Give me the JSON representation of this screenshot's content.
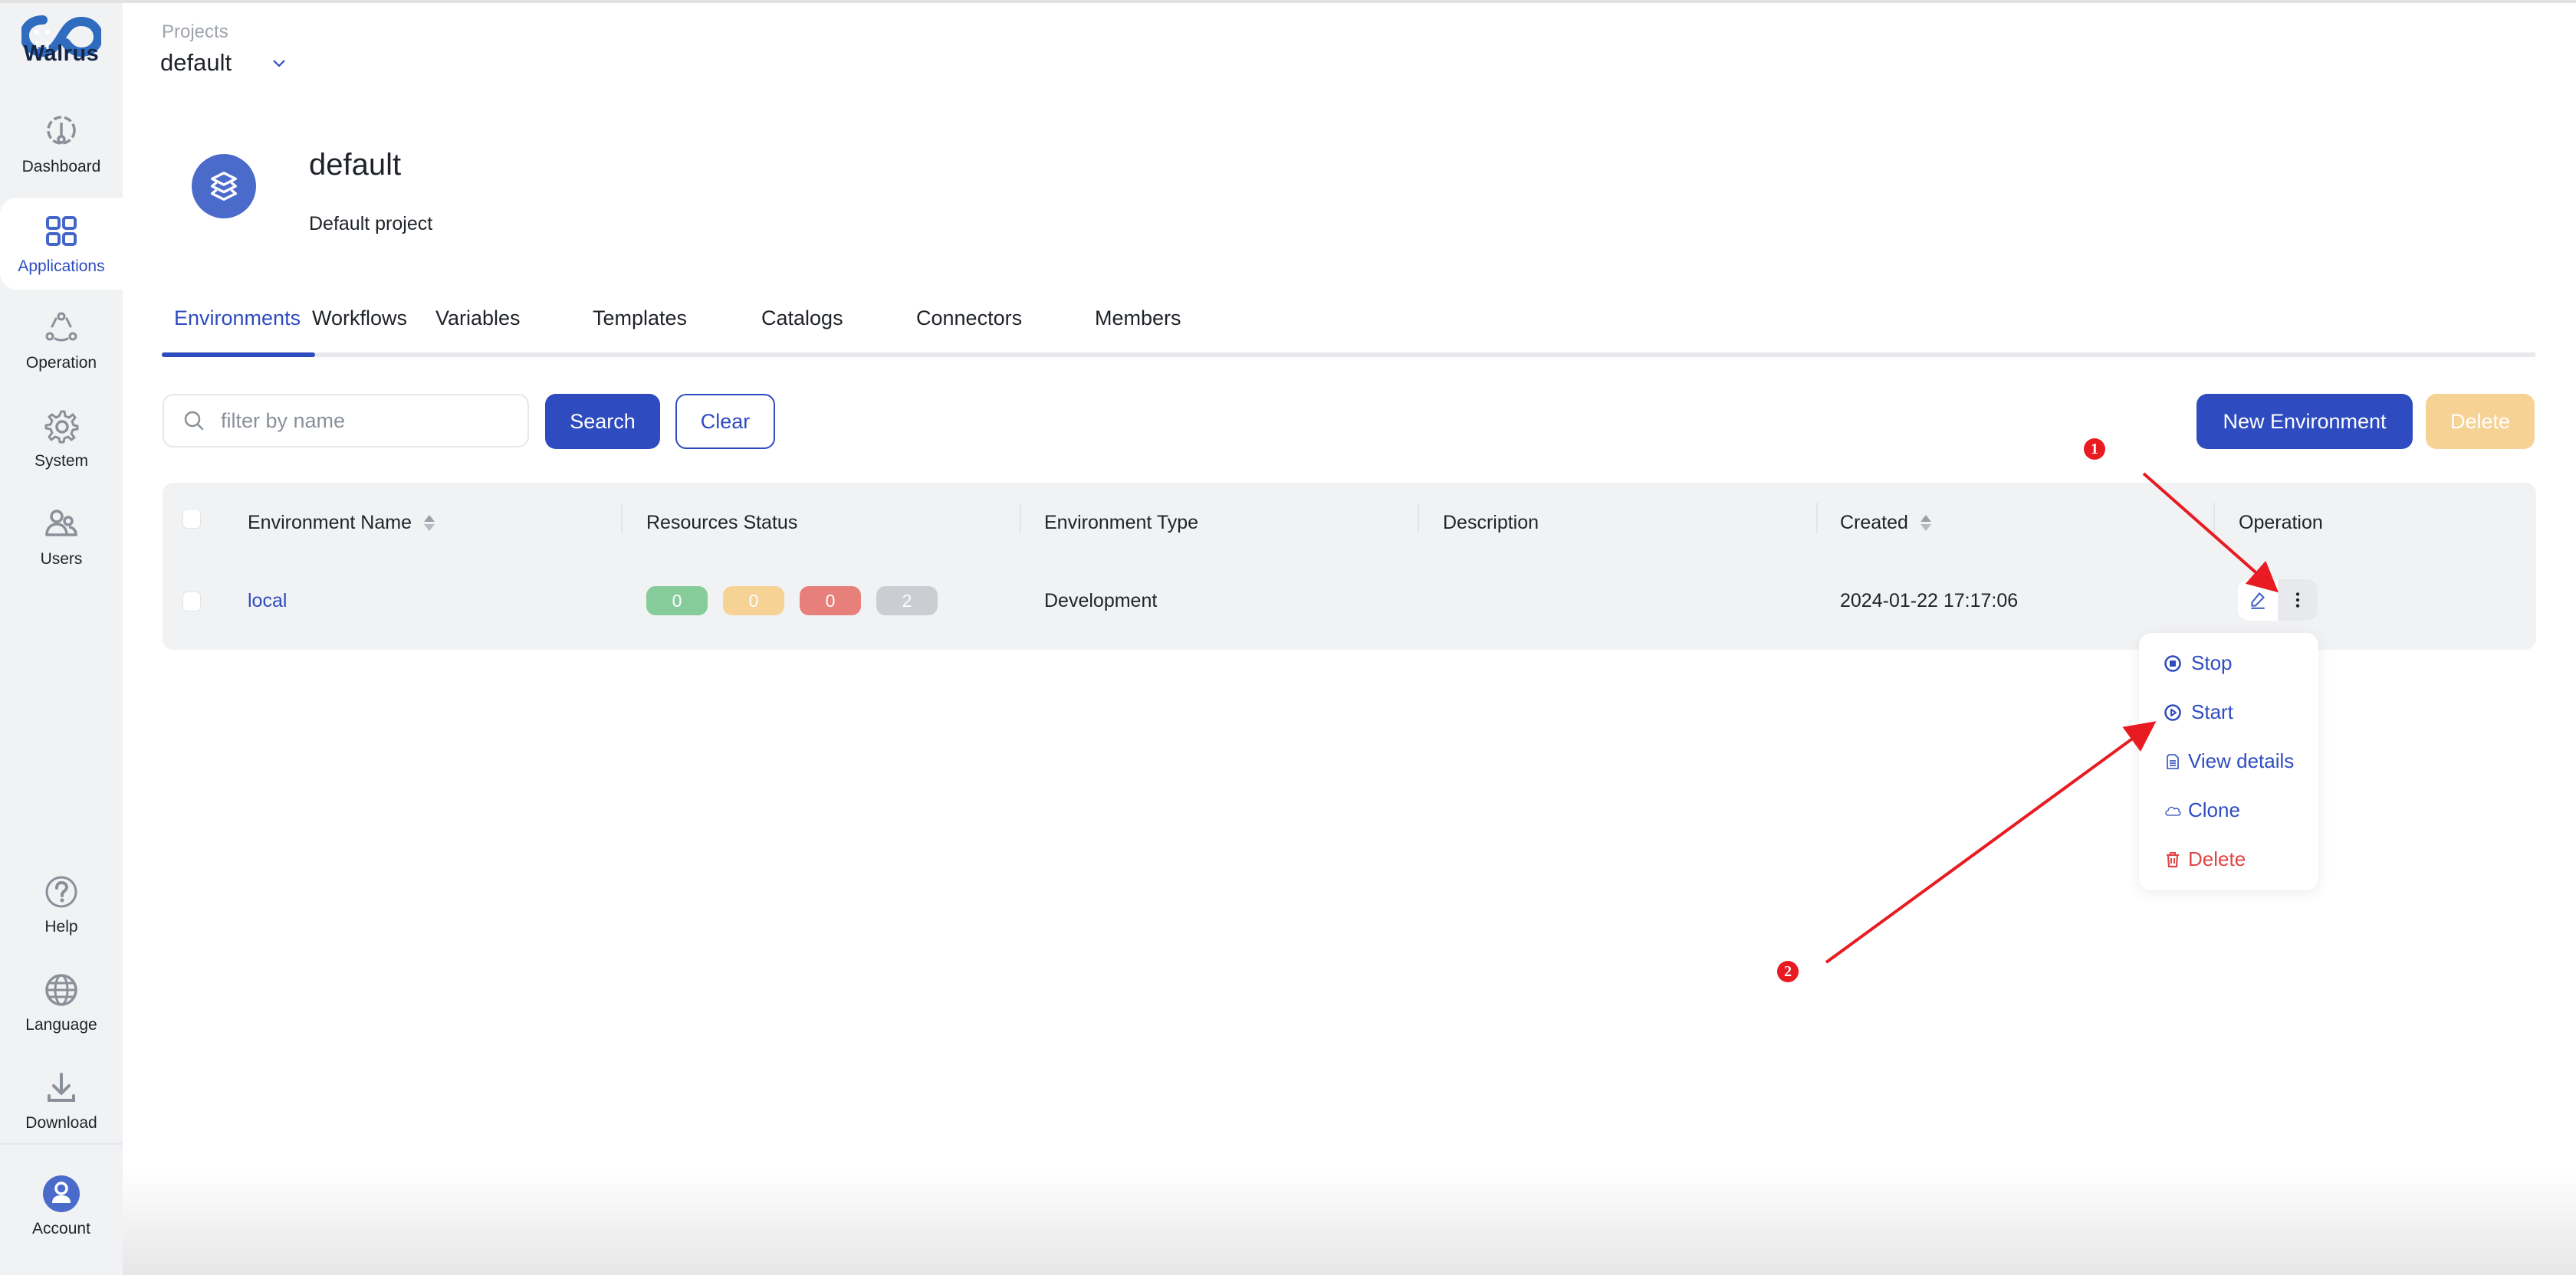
{
  "app": {
    "name": "Walrus"
  },
  "sidebar": {
    "items": [
      {
        "label": "Dashboard",
        "icon": "dashboard-icon",
        "active": false
      },
      {
        "label": "Applications",
        "icon": "applications-grid-icon",
        "active": true
      },
      {
        "label": "Operation",
        "icon": "operation-icon",
        "active": false
      },
      {
        "label": "System",
        "icon": "gear-icon",
        "active": false
      },
      {
        "label": "Users",
        "icon": "users-icon",
        "active": false
      }
    ],
    "bottom_items": [
      {
        "label": "Help",
        "icon": "help-icon"
      },
      {
        "label": "Language",
        "icon": "globe-icon"
      },
      {
        "label": "Download",
        "icon": "download-icon"
      }
    ],
    "account": {
      "label": "Account",
      "icon": "account-avatar-icon"
    }
  },
  "header": {
    "projects_label": "Projects",
    "selected_project": "default"
  },
  "project": {
    "title": "default",
    "description": "Default project",
    "icon": "layers-icon"
  },
  "tabs": [
    {
      "label": "Environments",
      "active": true
    },
    {
      "label": "Workflows",
      "active": false
    },
    {
      "label": "Variables",
      "active": false
    },
    {
      "label": "Templates",
      "active": false
    },
    {
      "label": "Catalogs",
      "active": false
    },
    {
      "label": "Connectors",
      "active": false
    },
    {
      "label": "Members",
      "active": false
    }
  ],
  "toolbar": {
    "search_placeholder": "filter by name",
    "search_value": "",
    "search_label": "Search",
    "clear_label": "Clear",
    "new_label": "New Environment",
    "delete_label": "Delete"
  },
  "table": {
    "columns": [
      {
        "label": "Environment Name",
        "sortable": true
      },
      {
        "label": "Resources Status",
        "sortable": false
      },
      {
        "label": "Environment Type",
        "sortable": false
      },
      {
        "label": "Description",
        "sortable": false
      },
      {
        "label": "Created",
        "sortable": true
      },
      {
        "label": "Operation",
        "sortable": false
      }
    ],
    "rows": [
      {
        "name": "local",
        "status_counts": [
          {
            "value": "0",
            "color": "#86cc9b",
            "kind": "ready"
          },
          {
            "value": "0",
            "color": "#f6d295",
            "kind": "transitioning"
          },
          {
            "value": "0",
            "color": "#e77f7a",
            "kind": "error"
          },
          {
            "value": "2",
            "color": "#cbcdd2",
            "kind": "inactive"
          }
        ],
        "type": "Development",
        "description": "",
        "created": "2024-01-22 17:17:06"
      }
    ]
  },
  "dropdown_menu": {
    "items": [
      {
        "label": "Stop",
        "icon": "stop-circle-icon",
        "danger": false
      },
      {
        "label": "Start",
        "icon": "play-circle-icon",
        "danger": false
      },
      {
        "label": "View details",
        "icon": "document-icon",
        "danger": false
      },
      {
        "label": "Clone",
        "icon": "cloud-icon",
        "danger": false
      },
      {
        "label": "Delete",
        "icon": "trash-icon",
        "danger": true
      }
    ]
  },
  "annotations": {
    "markers": [
      {
        "label": "1"
      },
      {
        "label": "2"
      }
    ],
    "color": "#e81b22"
  },
  "colors": {
    "primary": "#2e4cbf",
    "warning": "#f6d295",
    "danger": "#e04646",
    "sidebar_bg": "#f1f2f4"
  }
}
